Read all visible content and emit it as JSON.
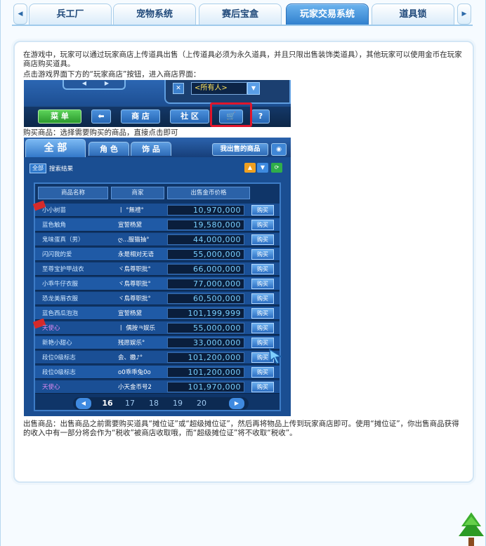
{
  "tabs": {
    "prev_icon": "triangle-left-icon",
    "next_icon": "triangle-right-icon",
    "items": [
      "兵工厂",
      "宠物系统",
      "赛后宝盒",
      "玩家交易系统",
      "道具锁"
    ],
    "active": "玩家交易系统"
  },
  "article": {
    "intro": "在游戏中，玩家可以通过玩家商店上传道具出售（上传道具必须为永久道具，并且只限出售装饰类道具），其他玩家可以使用金币在玩家商店购买道具。",
    "step_open": "点击游戏界面下方的“玩家商店”按钮，进入商店界面：",
    "step_buy": "购买商品：选择需要购买的商品，直接点击即可",
    "step_sell": "出售商品：出售商品之前需要购买道具“摊位证”或“超级摊位证”，然后再将物品上传到玩家商店即可。使用“摊位证”，你出售商品获得的收入中有一部分将会作为“税收”被商店收取哦，而“超级摊位证”将不收取“税收”。"
  },
  "toolbar_shot": {
    "filter_value": "<所有人>",
    "buttons": {
      "menu": "菜 单",
      "back_icon": "arrow-left-icon",
      "shop": "商 店",
      "community": "社 区",
      "player_shop_icon": "stall-cart-icon",
      "help": "?"
    },
    "highlight_color": "#e0162c"
  },
  "shop_shot": {
    "tabs": {
      "all": "全 部",
      "role": "角 色",
      "item": "饰 品"
    },
    "my_sale_button": "我出售的商品",
    "all_icon_label": "全部",
    "result_label": "搜索结果",
    "headers": [
      "商品名称",
      "商家",
      "出售金币价格"
    ],
    "buy_label": "购买",
    "rows": [
      {
        "name": "小小树苗",
        "seller": "丨 °無禮°",
        "price": "10,970,000",
        "hot": true,
        "purple": false
      },
      {
        "name": "蓝色触角",
        "seller": "宣誓杨黛",
        "price": "19,580,000",
        "hot": false,
        "purple": false
      },
      {
        "name": "鬼味蛋真（男）",
        "seller": "ღ...服猫抽°",
        "price": "44,000,000",
        "hot": false,
        "purple": false
      },
      {
        "name": "闪闪我的爱",
        "seller": "永是相对无语",
        "price": "55,000,000",
        "hot": false,
        "purple": false
      },
      {
        "name": "至尊宝护甲战衣",
        "seller": "ヾ鳥尊职批°",
        "price": "66,000,000",
        "hot": false,
        "purple": false
      },
      {
        "name": "小乖牛仔衣服",
        "seller": "ヾ鳥尊职批°",
        "price": "77,000,000",
        "hot": false,
        "purple": false
      },
      {
        "name": "恐龙美眉衣服",
        "seller": "ヾ鳥尊职批°",
        "price": "60,500,000",
        "hot": false,
        "purple": false
      },
      {
        "name": "蓝色西瓜泡泡",
        "seller": "宣誓杨黛",
        "price": "101,199,999",
        "hot": false,
        "purple": false
      },
      {
        "name": "天使心",
        "seller": "丨 偶按ㅋ娱乐",
        "price": "55,000,000",
        "hot": true,
        "purple": true
      },
      {
        "name": "新艳小甜心",
        "seller": "残愿娱乐°",
        "price": "33,000,000",
        "hot": false,
        "purple": false
      },
      {
        "name": "段位0级标志",
        "seller": "会、嫐♪°",
        "price": "101,200,000",
        "hot": false,
        "purple": false
      },
      {
        "name": "段位0级标志",
        "seller": "o0乖乖兔0o",
        "price": "101,200,000",
        "hot": false,
        "purple": false
      },
      {
        "name": "天使心",
        "seller": "小天金币号2",
        "price": "101,970,000",
        "hot": false,
        "purple": true
      }
    ],
    "pages": [
      "16",
      "17",
      "18",
      "19",
      "20"
    ],
    "current_page": "16",
    "pager_prev_icon": "pager-prev-icon",
    "pager_next_icon": "pager-next-icon",
    "cursor_icon": "mouse-cursor-icon"
  },
  "decor": {
    "tree_icon": "pine-tree-icon"
  }
}
